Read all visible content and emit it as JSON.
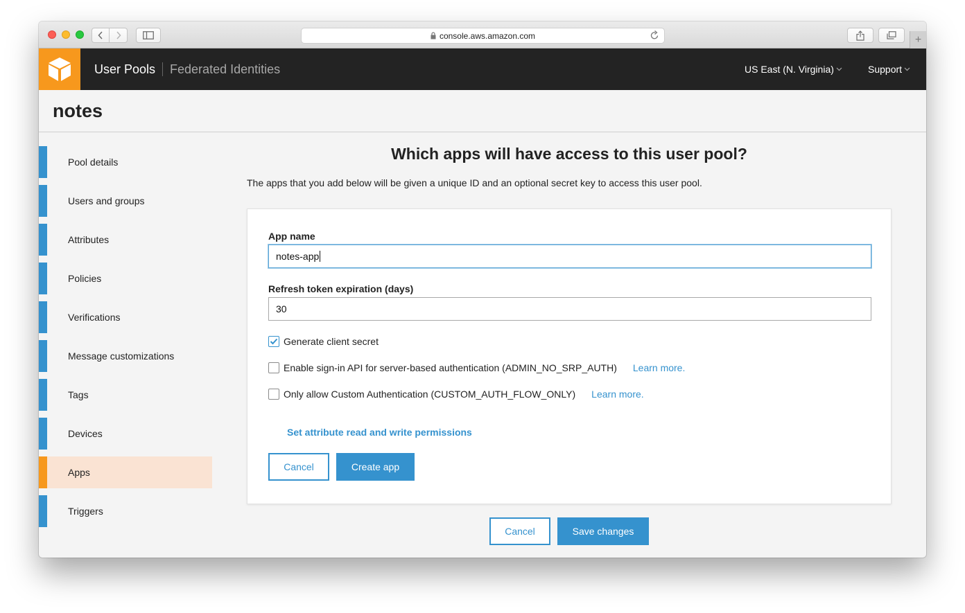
{
  "browser": {
    "url": "console.aws.amazon.com"
  },
  "header": {
    "nav_active": "User Pools",
    "nav_link": "Federated Identities",
    "region": "US East (N. Virginia)",
    "support": "Support"
  },
  "page": {
    "title": "notes"
  },
  "sidebar": {
    "items": [
      {
        "label": "Pool details"
      },
      {
        "label": "Users and groups"
      },
      {
        "label": "Attributes"
      },
      {
        "label": "Policies"
      },
      {
        "label": "Verifications"
      },
      {
        "label": "Message customizations"
      },
      {
        "label": "Tags"
      },
      {
        "label": "Devices"
      },
      {
        "label": "Apps",
        "active": true
      },
      {
        "label": "Triggers"
      }
    ]
  },
  "main": {
    "heading": "Which apps will have access to this user pool?",
    "description": "The apps that you add below will be given a unique ID and an optional secret key to access this user pool.",
    "form": {
      "app_name_label": "App name",
      "app_name_value": "notes-app",
      "refresh_label": "Refresh token expiration (days)",
      "refresh_value": "30",
      "checkboxes": [
        {
          "label": "Generate client secret",
          "checked": true
        },
        {
          "label": "Enable sign-in API for server-based authentication (ADMIN_NO_SRP_AUTH)",
          "checked": false,
          "link": "Learn more."
        },
        {
          "label": "Only allow Custom Authentication (CUSTOM_AUTH_FLOW_ONLY)",
          "checked": false,
          "link": "Learn more."
        }
      ],
      "permissions_link": "Set attribute read and write permissions",
      "cancel_label": "Cancel",
      "create_label": "Create app"
    },
    "footer": {
      "cancel_label": "Cancel",
      "save_label": "Save changes"
    }
  },
  "colors": {
    "accent": "#3592ce",
    "aws_orange": "#f7981d",
    "header_bg": "#232323",
    "active_item_bg": "#fae3d3"
  }
}
